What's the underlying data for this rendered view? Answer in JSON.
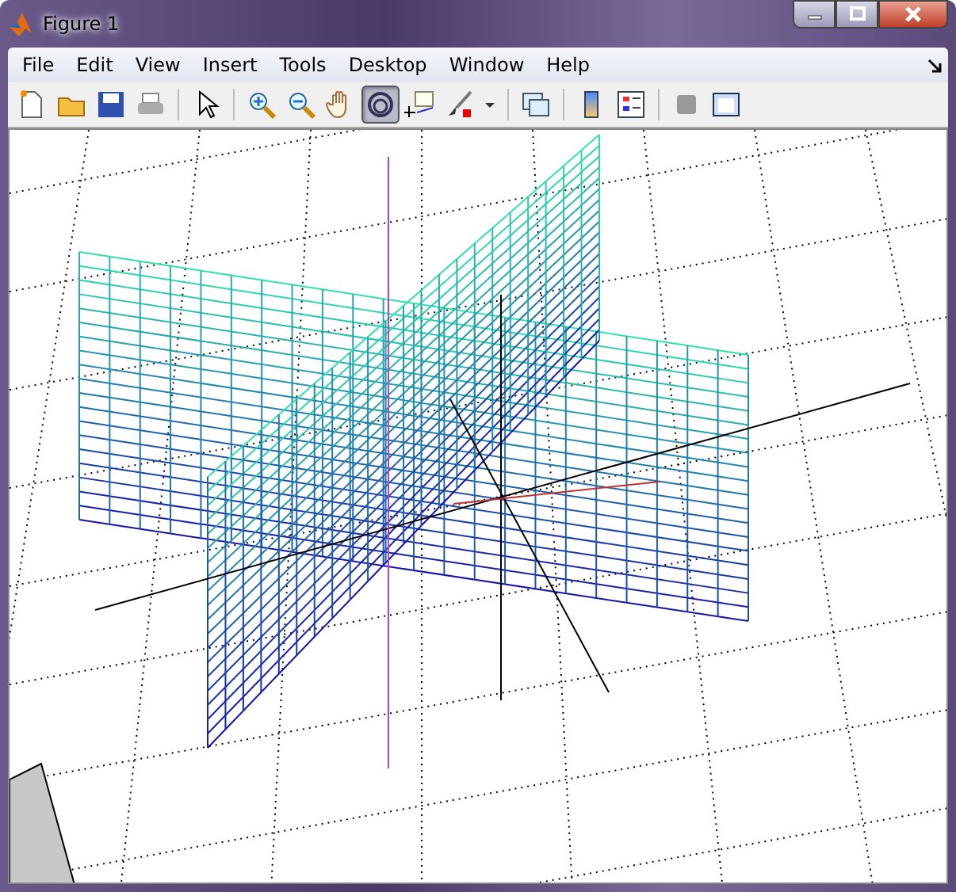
{
  "window": {
    "title": "Figure 1"
  },
  "menu": [
    "File",
    "Edit",
    "View",
    "Insert",
    "Tools",
    "Desktop",
    "Window",
    "Help"
  ],
  "toolbar": [
    {
      "kind": "new",
      "selected": false
    },
    {
      "kind": "open",
      "selected": false
    },
    {
      "kind": "save",
      "selected": false
    },
    {
      "kind": "print",
      "selected": false
    },
    {
      "kind": "separator"
    },
    {
      "kind": "pointer",
      "selected": false
    },
    {
      "kind": "separator"
    },
    {
      "kind": "zoom-in",
      "selected": false
    },
    {
      "kind": "zoom-out",
      "selected": false
    },
    {
      "kind": "pan",
      "selected": false
    },
    {
      "kind": "rotate",
      "selected": true
    },
    {
      "kind": "cursor",
      "selected": false
    },
    {
      "kind": "brush",
      "selected": false
    },
    {
      "kind": "caret",
      "selected": false
    },
    {
      "kind": "separator"
    },
    {
      "kind": "link",
      "selected": false
    },
    {
      "kind": "separator"
    },
    {
      "kind": "colorbar",
      "selected": false
    },
    {
      "kind": "legend",
      "selected": false
    },
    {
      "kind": "separator"
    },
    {
      "kind": "hide",
      "selected": false
    },
    {
      "kind": "show",
      "selected": false
    }
  ]
}
